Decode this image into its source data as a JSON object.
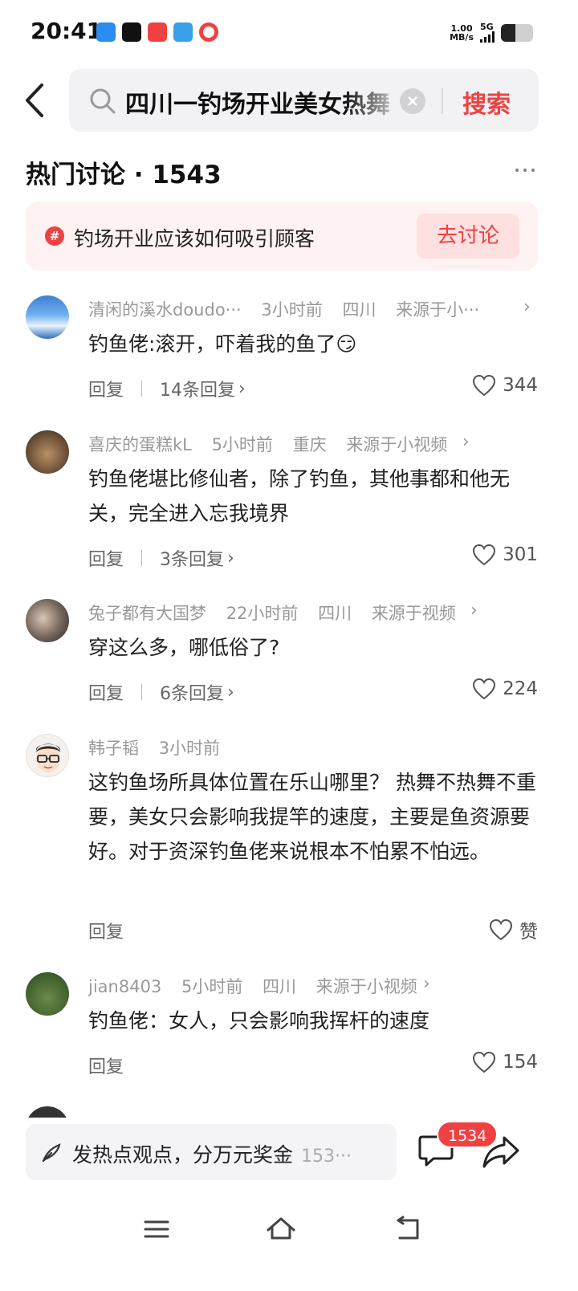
{
  "status": {
    "time": "20:41",
    "netspeed_value": "1.00",
    "netspeed_unit": "MB/s",
    "network": "5G",
    "battery_level": 0.45
  },
  "search": {
    "query": "四川一钓场开业美女热舞",
    "button_label": "搜索"
  },
  "hot": {
    "title": "热门讨论 · 1543",
    "topic": "钓场开业应该如何吸引顾客",
    "topic_hash": "#",
    "topic_button": "去讨论"
  },
  "comments": [
    {
      "user": "清闲的溪水doudo···",
      "time": "3小时前",
      "location": "四川",
      "source": "来源于小···",
      "text": "钓鱼佬:滚开，吓着我的鱼了😏",
      "reply_label": "回复",
      "replies": "14条回复",
      "likes": "344"
    },
    {
      "user": "喜庆的蛋糕kL",
      "time": "5小时前",
      "location": "重庆",
      "source": "来源于小视频",
      "text": "钓鱼佬堪比修仙者，除了钓鱼，其他事都和他无关，完全进入忘我境界",
      "reply_label": "回复",
      "replies": "3条回复",
      "likes": "301"
    },
    {
      "user": "兔子都有大国梦",
      "time": "22小时前",
      "location": "四川",
      "source": "来源于视频",
      "text": "穿这么多，哪低俗了?",
      "reply_label": "回复",
      "replies": "6条回复",
      "likes": "224"
    },
    {
      "user": "韩子韬",
      "time": "3小时前",
      "text": "这钓鱼场所具体位置在乐山哪里？ 热舞不热舞不重要，美女只会影响我提竿的速度，主要是鱼资源要好。对于资深钓鱼佬来说根本不怕累不怕远。",
      "reply_label": "回复",
      "likes": "赞"
    },
    {
      "user": "jian8403",
      "time": "5小时前",
      "location": "四川",
      "source": "来源于小视频",
      "text": "钓鱼佬：女人，只会影响我挥杆的速度",
      "reply_label": "回复",
      "likes": "154"
    }
  ],
  "bottom": {
    "input_placeholder": "发热点观点，分万元奖金",
    "input_count": "153···",
    "comment_badge": "1534"
  },
  "colors": {
    "accent": "#f04142",
    "topic_bg": "#fff2f2",
    "meta_text": "#999999"
  }
}
